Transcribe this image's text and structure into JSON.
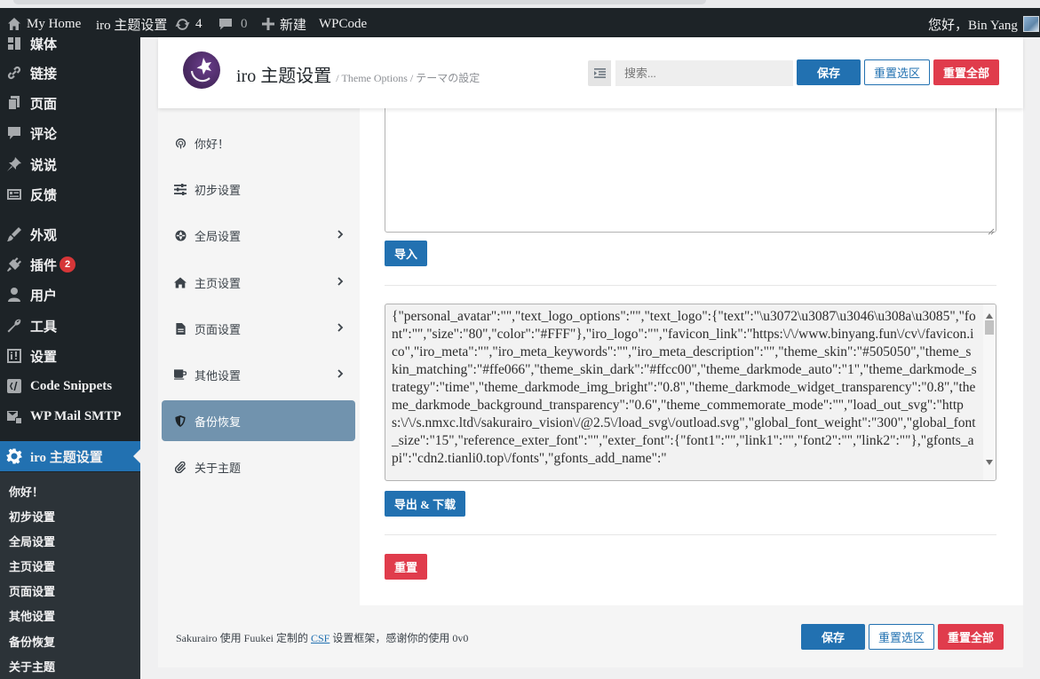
{
  "adminbar": {
    "site_name": "My Home",
    "theme_link": "iro 主题设置",
    "updates_count": "4",
    "comments_count": "0",
    "new_label": "新建",
    "wpcode_label": "WPCode",
    "greeting": "您好，Bin Yang"
  },
  "sidebar": {
    "items": [
      {
        "label": "媒体",
        "icon": "media-icon"
      },
      {
        "label": "链接",
        "icon": "link-icon"
      },
      {
        "label": "页面",
        "icon": "page-icon"
      },
      {
        "label": "评论",
        "icon": "comment-icon"
      },
      {
        "label": "说说",
        "icon": "pin-icon"
      },
      {
        "label": "反馈",
        "icon": "feedback-icon"
      },
      {
        "label": "外观",
        "icon": "appearance-icon"
      },
      {
        "label": "插件",
        "icon": "plugin-icon",
        "badge": "2"
      },
      {
        "label": "用户",
        "icon": "user-icon"
      },
      {
        "label": "工具",
        "icon": "wrench-icon"
      },
      {
        "label": "设置",
        "icon": "settings-icon"
      },
      {
        "label": "Code Snippets",
        "icon": "snippet-icon"
      },
      {
        "label": "WP Mail SMTP",
        "icon": "mail-icon"
      },
      {
        "label": "iro 主题设置",
        "icon": "gear-icon"
      }
    ],
    "submenu": [
      "你好！",
      "初步设置",
      "全局设置",
      "主页设置",
      "页面设置",
      "其他设置",
      "备份恢复",
      "关于主题"
    ]
  },
  "header": {
    "title": "iro 主题设置",
    "subtitle": "/ Theme Options / テーマの設定",
    "search_placeholder": "搜索...",
    "save": "保存",
    "reset_section": "重置选区",
    "reset_all": "重置全部"
  },
  "nav": {
    "items": [
      {
        "label": "你好！",
        "icon": "podcast-icon"
      },
      {
        "label": "初步设置",
        "icon": "sliders-icon"
      },
      {
        "label": "全局设置",
        "icon": "globe-icon"
      },
      {
        "label": "主页设置",
        "icon": "home-icon"
      },
      {
        "label": "页面设置",
        "icon": "file-icon"
      },
      {
        "label": "其他设置",
        "icon": "coffee-icon"
      },
      {
        "label": "备份恢复",
        "icon": "shield-icon"
      },
      {
        "label": "关于主题",
        "icon": "paperclip-icon"
      }
    ]
  },
  "content": {
    "import_button": "导入",
    "export_text": "{\"personal_avatar\":\"\",\"text_logo_options\":\"\",\"text_logo\":{\"text\":\"\\u3072\\u3087\\u3046\\u308a\\u3085\",\"font\":\"\",\"size\":\"80\",\"color\":\"#FFF\"},\"iro_logo\":\"\",\"favicon_link\":\"https:\\/\\/www.binyang.fun\\/cv\\/favicon.ico\",\"iro_meta\":\"\",\"iro_meta_keywords\":\"\",\"iro_meta_description\":\"\",\"theme_skin\":\"#505050\",\"theme_skin_matching\":\"#ffe066\",\"theme_skin_dark\":\"#ffcc00\",\"theme_darkmode_auto\":\"1\",\"theme_darkmode_strategy\":\"time\",\"theme_darkmode_img_bright\":\"0.8\",\"theme_darkmode_widget_transparency\":\"0.8\",\"theme_darkmode_background_transparency\":\"0.6\",\"theme_commemorate_mode\":\"\",\"load_out_svg\":\"https:\\/\\/s.nmxc.ltd\\/sakurairo_vision\\/@2.5\\/load_svg\\/outload.svg\",\"global_font_weight\":\"300\",\"global_font_size\":\"15\",\"reference_exter_font\":\"\",\"exter_font\":{\"font1\":\"\",\"link1\":\"\",\"font2\":\"\",\"link2\":\"\"},\"gfonts_api\":\"cdn2.tianli0.top\\/fonts\",\"gfonts_add_name\":\"",
    "export_button": "导出 & 下载",
    "reset_button": "重置"
  },
  "footer": {
    "text_before": "Sakurairo 使用 Fuukei 定制的 ",
    "link": "CSF",
    "text_after": " 设置框架，感谢你的使用 0v0",
    "save": "保存",
    "reset_section": "重置选区",
    "reset_all": "重置全部"
  }
}
